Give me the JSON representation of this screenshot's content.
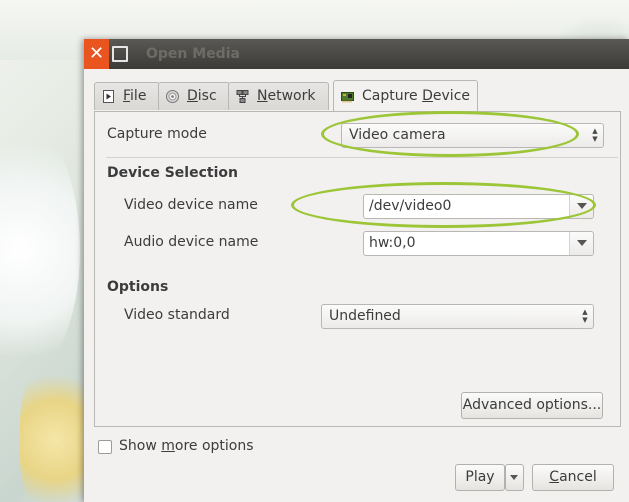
{
  "window": {
    "title": "Open Media",
    "close_glyph": "✕"
  },
  "tabs": [
    {
      "label_pre": "",
      "mnemonic": "F",
      "label_post": "ile",
      "icon": "file-icon"
    },
    {
      "label_pre": "",
      "mnemonic": "D",
      "label_post": "isc",
      "icon": "disc-icon"
    },
    {
      "label_pre": "",
      "mnemonic": "N",
      "label_post": "etwork",
      "icon": "network-icon"
    },
    {
      "label_pre": "Capture ",
      "mnemonic": "D",
      "label_post": "evice",
      "icon": "capture-card-icon"
    }
  ],
  "capture": {
    "mode_label": "Capture mode",
    "mode_value": "Video camera",
    "device_section": "Device Selection",
    "video_device_label": "Video device name",
    "video_device_value": "/dev/video0",
    "audio_device_label": "Audio device name",
    "audio_device_value": "hw:0,0",
    "options_section": "Options",
    "video_standard_label": "Video standard",
    "video_standard_value": "Undefined",
    "advanced_button": "Advanced options..."
  },
  "footer": {
    "show_more_pre": "Show ",
    "show_more_mnemonic": "m",
    "show_more_post": "ore options",
    "play_button": "Play",
    "cancel_pre": "",
    "cancel_mnemonic": "C",
    "cancel_post": "ancel"
  },
  "colors": {
    "accent_ring": "#9cc637",
    "close_button": "#e9541f"
  }
}
